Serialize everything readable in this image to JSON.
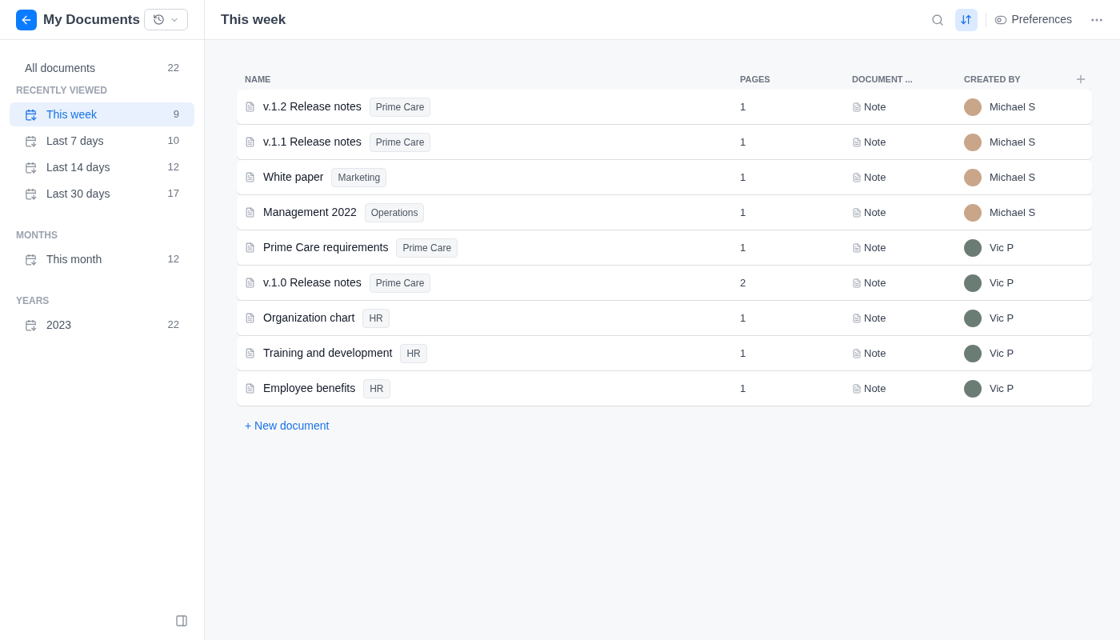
{
  "sidebar": {
    "title": "My Documents",
    "all": {
      "label": "All documents",
      "count": "22",
      "selected": false
    },
    "sections": [
      {
        "heading": "RECENTLY VIEWED",
        "items": [
          {
            "label": "This week",
            "count": "9",
            "selected": true
          },
          {
            "label": "Last 7 days",
            "count": "10",
            "selected": false
          },
          {
            "label": "Last 14 days",
            "count": "12",
            "selected": false
          },
          {
            "label": "Last 30 days",
            "count": "17",
            "selected": false
          }
        ]
      },
      {
        "heading": "MONTHS",
        "items": [
          {
            "label": "This month",
            "count": "12",
            "selected": false
          }
        ]
      },
      {
        "heading": "YEARS",
        "items": [
          {
            "label": "2023",
            "count": "22",
            "selected": false
          }
        ]
      }
    ]
  },
  "header": {
    "title": "This week",
    "sort_selected": true,
    "preferences": "Preferences"
  },
  "table": {
    "columns": [
      "NAME",
      "PAGES",
      "DOCUMENT ...",
      "CREATED BY"
    ],
    "rows": [
      {
        "name": "v.1.2 Release notes",
        "tag": "Prime Care",
        "pages": "1",
        "type": "Note",
        "created_by": "Michael S"
      },
      {
        "name": "v.1.1 Release notes",
        "tag": "Prime Care",
        "pages": "1",
        "type": "Note",
        "created_by": "Michael S"
      },
      {
        "name": "White paper",
        "tag": "Marketing",
        "pages": "1",
        "type": "Note",
        "created_by": "Michael S"
      },
      {
        "name": "Management 2022",
        "tag": "Operations",
        "pages": "1",
        "type": "Note",
        "created_by": "Michael S"
      },
      {
        "name": "Prime Care requirements",
        "tag": "Prime Care",
        "pages": "1",
        "type": "Note",
        "created_by": "Vic P"
      },
      {
        "name": "v.1.0 Release notes",
        "tag": "Prime Care",
        "pages": "2",
        "type": "Note",
        "created_by": "Vic P"
      },
      {
        "name": "Organization chart",
        "tag": "HR",
        "pages": "1",
        "type": "Note",
        "created_by": "Vic P"
      },
      {
        "name": "Training and development",
        "tag": "HR",
        "pages": "1",
        "type": "Note",
        "created_by": "Vic P"
      },
      {
        "name": "Employee benefits",
        "tag": "HR",
        "pages": "1",
        "type": "Note",
        "created_by": "Vic P"
      }
    ],
    "new_document": "+ New document"
  }
}
